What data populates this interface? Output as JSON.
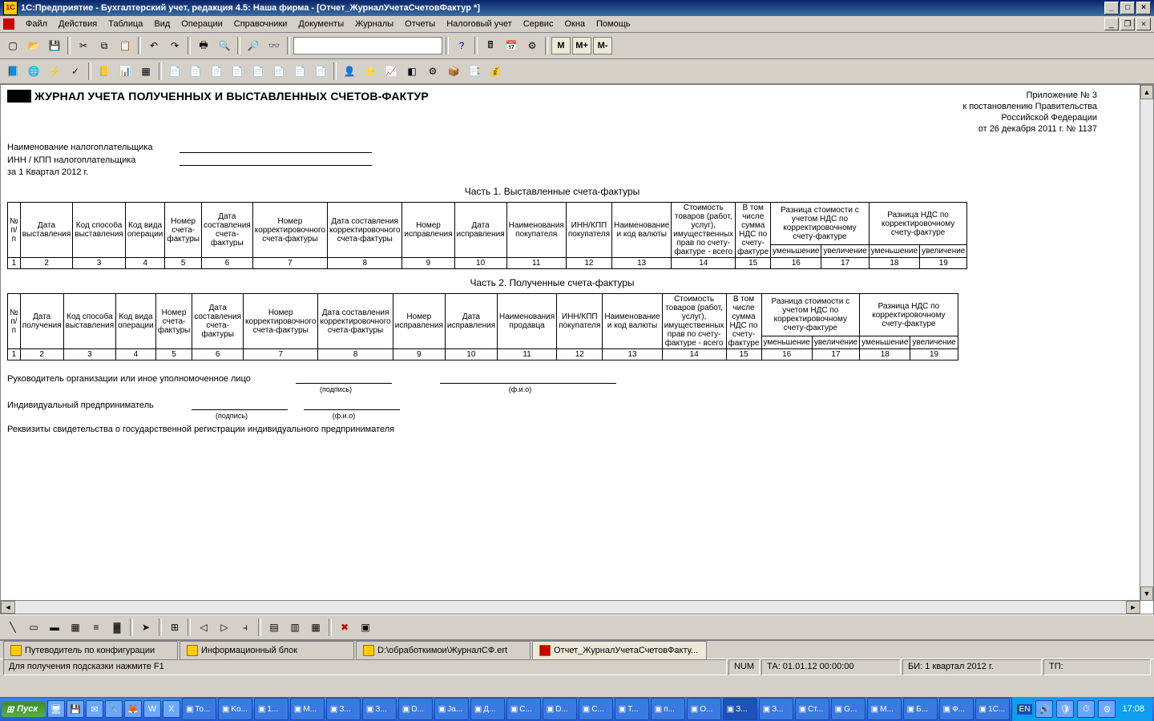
{
  "titlebar": {
    "text": "1С:Предприятие - Бухгалтерский учет, редакция 4.5: Наша фирма - [Отчет_ЖурналУчетаСчетовФактур *]"
  },
  "menu": {
    "items": [
      "Файл",
      "Действия",
      "Таблица",
      "Вид",
      "Операции",
      "Справочники",
      "Документы",
      "Журналы",
      "Отчеты",
      "Налоговый учет",
      "Сервис",
      "Окна",
      "Помощь"
    ]
  },
  "toolbar1": {
    "icons": [
      "new-doc-icon",
      "open-icon",
      "save-icon",
      "cut-icon",
      "copy-icon",
      "paste-icon",
      "undo-icon",
      "redo-icon",
      "find-icon",
      "calc-icon",
      "calendar-icon",
      "help-icon"
    ],
    "m_buttons": [
      "M",
      "M+",
      "M-"
    ]
  },
  "toolbar2": {
    "icons": [
      "guide-icon",
      "tree-icon",
      "ops-icon",
      "post-icon",
      "journal-icon",
      "plan-icon",
      "grid-icon",
      "doc1-icon",
      "doc2-icon",
      "doc3-icon",
      "doc4-icon",
      "doc5-icon",
      "doc6-icon",
      "doc7-icon",
      "doc8-icon",
      "user-icon",
      "star-icon",
      "chart-icon",
      "cube-icon",
      "gear-icon",
      "box-icon",
      "report-icon",
      "tax-icon"
    ]
  },
  "document": {
    "title": "ЖУРНАЛ УЧЕТА ПОЛУЧЕННЫХ И ВЫСТАВЛЕННЫХ СЧЕТОВ-ФАКТУР",
    "annex": {
      "l1": "Приложение № 3",
      "l2": "к постановлению Правительства",
      "l3": "Российской Федерации",
      "l4": "от 26 декабря 2011 г. № 1137"
    },
    "info": {
      "taxpayer_label": "Наименование налогоплательщика",
      "inn_label": "ИНН / КПП налогоплательщика",
      "period_label": "за 1 Квартал 2012 г."
    },
    "part1_title": "Часть 1. Выставленные счета-фактуры",
    "part2_title": "Часть 2. Полученные счета-фактуры",
    "headers1": {
      "c1": "№ п/п",
      "c2": "Дата выставления",
      "c3": "Код способа выставления",
      "c4": "Код вида операции",
      "c5": "Номер счета-фактуры",
      "c6": "Дата составления счета-фактуры",
      "c7": "Номер корректировочного счета-фактуры",
      "c8": "Дата составления корректировочного счета-фактуры",
      "c9": "Номер исправления",
      "c10": "Дата исправления",
      "c11": "Наименования покупателя",
      "c12": "ИНН/КПП покупателя",
      "c13": "Наименование и код валюты",
      "c14": "Стоимость товаров (работ, услуг), имущественных прав по счету-фактуре - всего",
      "c15": "В том числе сумма НДС по счету-фактуре",
      "c16_17": "Разница стоимости с учетом НДС по корректировочному счету-фактуре",
      "c18_19": "Разница НДС по корректировочному счету-фактуре",
      "dec": "уменьшение",
      "inc": "увеличение"
    },
    "headers2": {
      "c1": "№ п/п",
      "c2": "Дата получения",
      "c3": "Код способа выставления",
      "c4": "Код вида операции",
      "c5": "Номер счета-фактуры",
      "c6": "Дата составления счета-фактуры",
      "c7": "Номер корректировочного счета-фактуры",
      "c8": "Дата составления корректировочного счета-фактуры",
      "c9": "Номер исправления",
      "c10": "Дата исправления",
      "c11": "Наименования продавца",
      "c12": "ИНН/КПП покупателя",
      "c13": "Наименование и код валюты",
      "c14": "Стоимость товаров (работ, услуг), имущественных прав по счету-фактуре - всего",
      "c15": "В том числе сумма НДС по счету-фактуре",
      "c16_17": "Разница стоимости с учетом НДС по корректировочному счету-фактуре",
      "c18_19": "Разница НДС по корректировочному счету-фактуре",
      "dec": "уменьшение",
      "inc": "увеличение"
    },
    "colnums": [
      "1",
      "2",
      "3",
      "4",
      "5",
      "6",
      "7",
      "8",
      "9",
      "10",
      "11",
      "12",
      "13",
      "14",
      "15",
      "16",
      "17",
      "18",
      "19"
    ],
    "sign": {
      "head_label": "Руководитель организации или иное уполномоченное лицо",
      "ip_label": "Индивидуальный предприниматель",
      "reg_label": "Реквизиты свидетельства о государственной регистрации индивидуального предпринимателя",
      "podpis": "(подпись)",
      "fio": "(ф.и.о)"
    }
  },
  "tabs": {
    "t1": "Путеводитель по конфигурации",
    "t2": "Информационный блок",
    "t3": "D:\\обработкимои\\ЖурналСФ.ert",
    "t4": "Отчет_ЖурналУчетаСчетовФакту..."
  },
  "statusbar": {
    "hint": "Для получения подсказки нажмите F1",
    "num": "NUM",
    "ta": "ТА: 01.01.12 00:00:00",
    "bi": "БИ: 1 квартал 2012 г.",
    "tp": "ТП:"
  },
  "taskbar": {
    "start": "Пуск",
    "tasks": [
      "To...",
      "Ko...",
      "1...",
      "М...",
      "З...",
      "З...",
      "D...",
      "Ja...",
      "Д...",
      "С...",
      "D...",
      "С...",
      "Т...",
      "п...",
      "О...",
      "З...",
      "З...",
      "Ст...",
      "G...",
      "M...",
      "Б...",
      "Ф...",
      "1С..."
    ],
    "lang": "EN",
    "clock": "17:08"
  }
}
